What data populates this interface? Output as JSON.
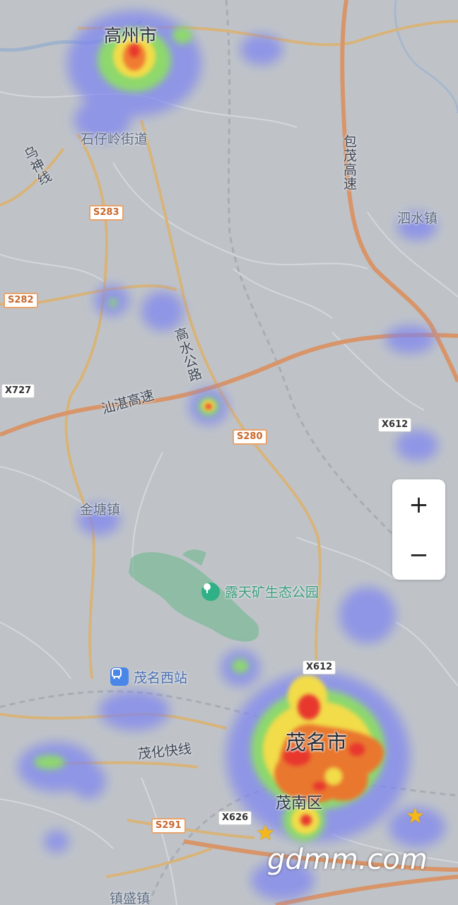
{
  "map": {
    "places": {
      "gaozhou": "高州市",
      "shizailing": "石仔岭街道",
      "sishui": "泗水镇",
      "jintang": "金塘镇",
      "maoming": "茂名市",
      "maonan": "茂南区",
      "zhensheng": "镇盛镇"
    },
    "roads": {
      "wushen": "乌神线",
      "baomao": "包茂高速",
      "gaoshui": "高水公路",
      "shanzhan": "汕湛高速",
      "maohua": "茂化快线"
    },
    "shields": {
      "s283": "S283",
      "s282": "S282",
      "x727": "X727",
      "s280": "S280",
      "x612a": "X612",
      "x612b": "X612",
      "x626": "X626",
      "s291": "S291"
    },
    "pois": {
      "park": "露天矿生态公园",
      "station": "茂名西站"
    },
    "colors": {
      "background": "#bfc3c8",
      "expressway": "#d8956a",
      "road_provincial": "#d8b47a",
      "park_area": "#7fb99a",
      "heat_low": "#7b83f2",
      "heat_mid": "#8ee060",
      "heat_high": "#f2dc4a",
      "heat_peak": "#e8392e"
    }
  },
  "controls": {
    "zoom_in": "+",
    "zoom_out": "−"
  },
  "watermark": "gdmm.com"
}
